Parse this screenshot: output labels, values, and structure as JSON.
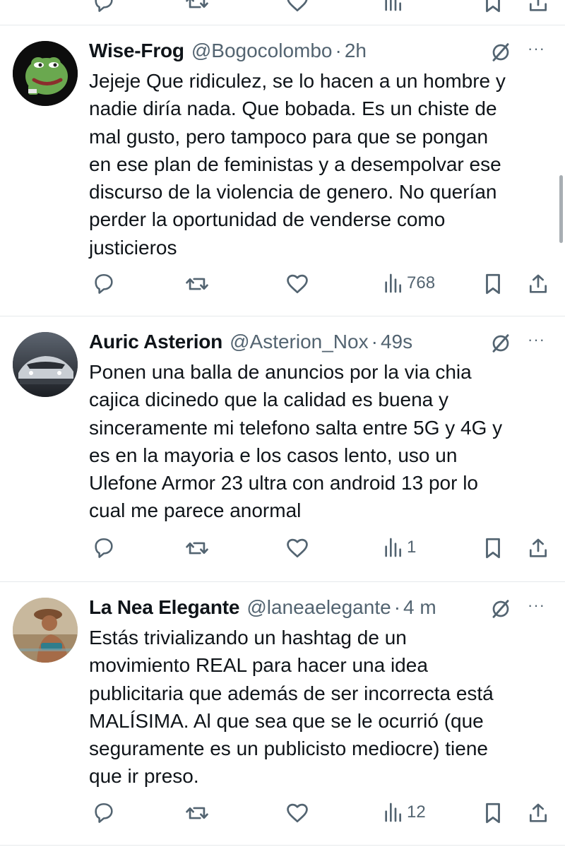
{
  "tweets": [
    {
      "name": "Wise-Frog",
      "handle": "@Bogocolombo",
      "time": "2h",
      "text": "Jejeje Que ridiculez, se lo hacen a un hombre y\nnadie diría nada. Que bobada. Es un chiste de\nmal gusto, pero tampoco para que se pongan\nen ese plan de feministas y a desempolvar ese\ndiscurso de la violencia de genero. No querían\nperder la oportunidad de venderse como\njusticieros",
      "views": "768",
      "avatar_icon": "frog-avatar-icon"
    },
    {
      "name": "Auric Asterion",
      "handle": "@Asterion_Nox",
      "time": "49s",
      "text": "Ponen una balla de anuncios por la via chia\ncajica dicinedo que la calidad es buena y\nsinceramente mi telefono salta entre 5G y 4G y\nes en la mayoria e los casos lento, uso un\nUlefone Armor 23 ultra con android 13 por lo\ncual me parece anormal",
      "views": "1",
      "avatar_icon": "car-avatar-icon"
    },
    {
      "name": "La Nea Elegante",
      "handle": "@laneaelegante",
      "time": "4 m",
      "text": "Estás trivializando un hashtag de un\nmovimiento REAL para hacer una idea\npublicitaria que además de ser incorrecta está\nMALÍSIMA. Al que sea que se le ocurrió (que\nseguramente es un publicisto mediocre) tiene\nque ir preso.",
      "views": "12",
      "avatar_icon": "person-avatar-icon"
    }
  ],
  "separator": "·",
  "more_glyph": "···",
  "colors": {
    "text": "#0f1419",
    "secondary": "#536471",
    "divider": "#e6e9eb",
    "background": "#ffffff"
  },
  "icons": [
    "reply-icon",
    "retweet-icon",
    "like-icon",
    "views-icon",
    "bookmark-icon",
    "share-icon",
    "grok-icon",
    "more-icon"
  ]
}
